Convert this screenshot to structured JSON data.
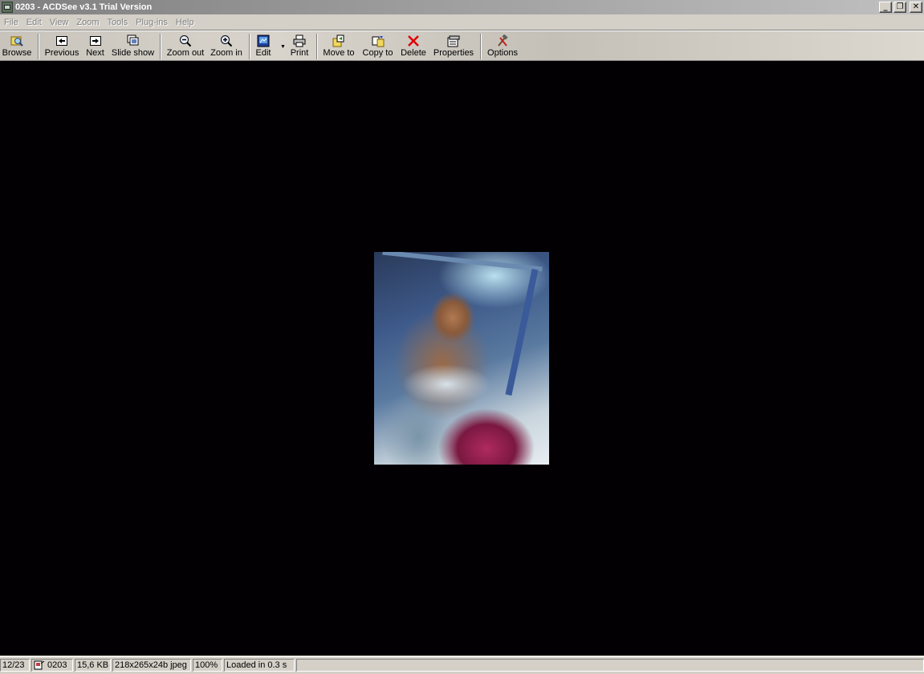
{
  "window": {
    "title": "0203 - ACDSee v3.1 Trial Version",
    "minimize_label": "_",
    "restore_label": "❐",
    "close_label": "✕"
  },
  "menu": [
    "File",
    "Edit",
    "View",
    "Zoom",
    "Tools",
    "Plug-ins",
    "Help"
  ],
  "toolbar": {
    "browse": "Browse",
    "previous": "Previous",
    "next": "Next",
    "slideshow": "Slide show",
    "zoom_out": "Zoom out",
    "zoom_in": "Zoom in",
    "edit": "Edit",
    "print": "Print",
    "move_to": "Move to",
    "copy_to": "Copy to",
    "delete": "Delete",
    "properties": "Properties",
    "options": "Options"
  },
  "status": {
    "position": "12/23",
    "filename": "0203",
    "filesize": "15,6 KB",
    "dimensions": "218x265x24b jpeg",
    "zoom": "100%",
    "load_time": "Loaded in 0.3 s"
  },
  "colors": {
    "viewer_background": "#020003",
    "delete_icon": "#e00000"
  }
}
